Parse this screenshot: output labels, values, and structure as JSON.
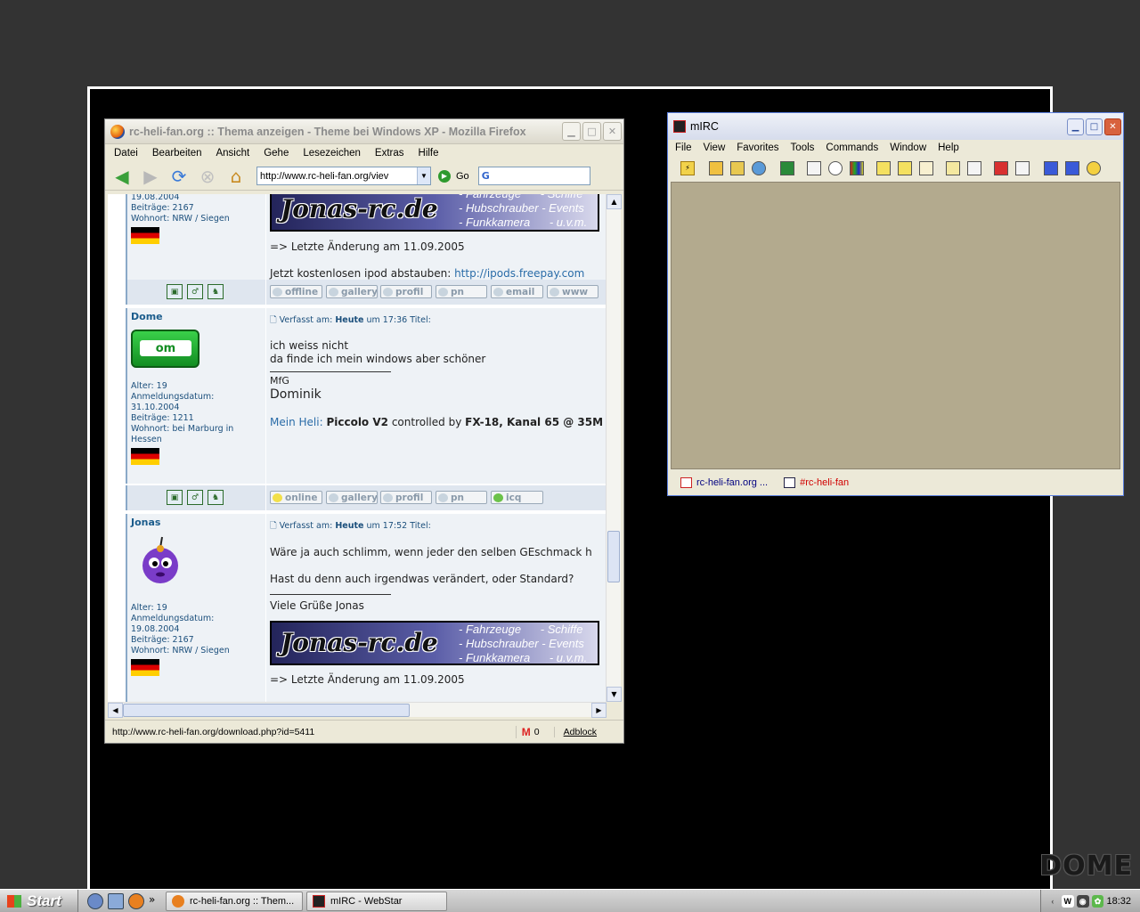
{
  "desktop": {
    "logo_text": "DOME"
  },
  "firefox": {
    "title": "rc-heli-fan.org :: Thema anzeigen - Theme bei Windows XP - Mozilla Firefox",
    "menu": [
      "Datei",
      "Bearbeiten",
      "Ansicht",
      "Gehe",
      "Lesezeichen",
      "Extras",
      "Hilfe"
    ],
    "url": "http://www.rc-heli-fan.org/viev",
    "go_label": "Go",
    "status_text": "http://www.rc-heli-fan.org/download.php?id=5411",
    "mail_count": "0",
    "adblock_label": "Adblock"
  },
  "posts": {
    "top": {
      "date_partial": "19.08.2004",
      "beitraege": "Beiträge: 2167",
      "wohnort": "Wohnort: NRW / Siegen",
      "last_change": "=> Letzte Änderung am 11.09.2005",
      "ipod_text": "Jetzt kostenlosen ipod abstauben:",
      "ipod_link": "http://ipods.freepay.com",
      "buttons": [
        "offline",
        "gallery",
        "profil",
        "pn",
        "email",
        "www"
      ]
    },
    "dome": {
      "name": "Dome",
      "avatar_text": "om",
      "alter": "Alter: 19",
      "anmeldung": "Anmeldungsdatum:",
      "anmeldung_date": "31.10.2004",
      "beitraege": "Beiträge: 1211",
      "wohnort": "Wohnort: bei Marburg in",
      "wohnort2": "Hessen",
      "verfasst": "Verfasst am:",
      "heute": "Heute",
      "time": "um 17:36",
      "titel": "Titel:",
      "line1": "ich weiss nicht",
      "line2": "da finde ich mein windows aber schöner",
      "mfg": "MfG",
      "sig_name": "Dominik",
      "heli_label": "Mein Heli:",
      "heli_model": "Piccolo V2",
      "controlled_by": "controlled by",
      "fx": "FX-18, Kanal 65 @ 35M",
      "buttons": [
        "online",
        "gallery",
        "profil",
        "pn",
        "icq"
      ]
    },
    "jonas": {
      "name": "Jonas",
      "alter": "Alter: 19",
      "anmeldung": "Anmeldungsdatum:",
      "anmeldung_date": "19.08.2004",
      "beitraege": "Beiträge: 2167",
      "wohnort": "Wohnort: NRW / Siegen",
      "verfasst": "Verfasst am:",
      "heute": "Heute",
      "time": "um 17:52",
      "titel": "Titel:",
      "line1": "Wäre ja auch schlimm, wenn jeder den selben GEschmack h",
      "line2": "Hast du denn auch irgendwas verändert, oder Standard?",
      "greeting": "Viele Grüße Jonas",
      "last_change": "=> Letzte Änderung am 11.09.2005"
    },
    "banner": {
      "logo": "Jonas-rc.de",
      "lines": [
        "- Fahrzeuge      - Schiffe",
        "- Hubschrauber - Events",
        "- Funkkamera      - u.v.m."
      ]
    }
  },
  "mirc": {
    "title": "mIRC",
    "menu": [
      "File",
      "View",
      "Favorites",
      "Tools",
      "Commands",
      "Window",
      "Help"
    ],
    "switchbar": [
      "rc-heli-fan.org ...",
      "#rc-heli-fan"
    ]
  },
  "taskbar": {
    "start_label": "Start",
    "tasks": [
      "rc-heli-fan.org :: Them...",
      "mIRC - WebStar"
    ],
    "clock": "18:32"
  }
}
